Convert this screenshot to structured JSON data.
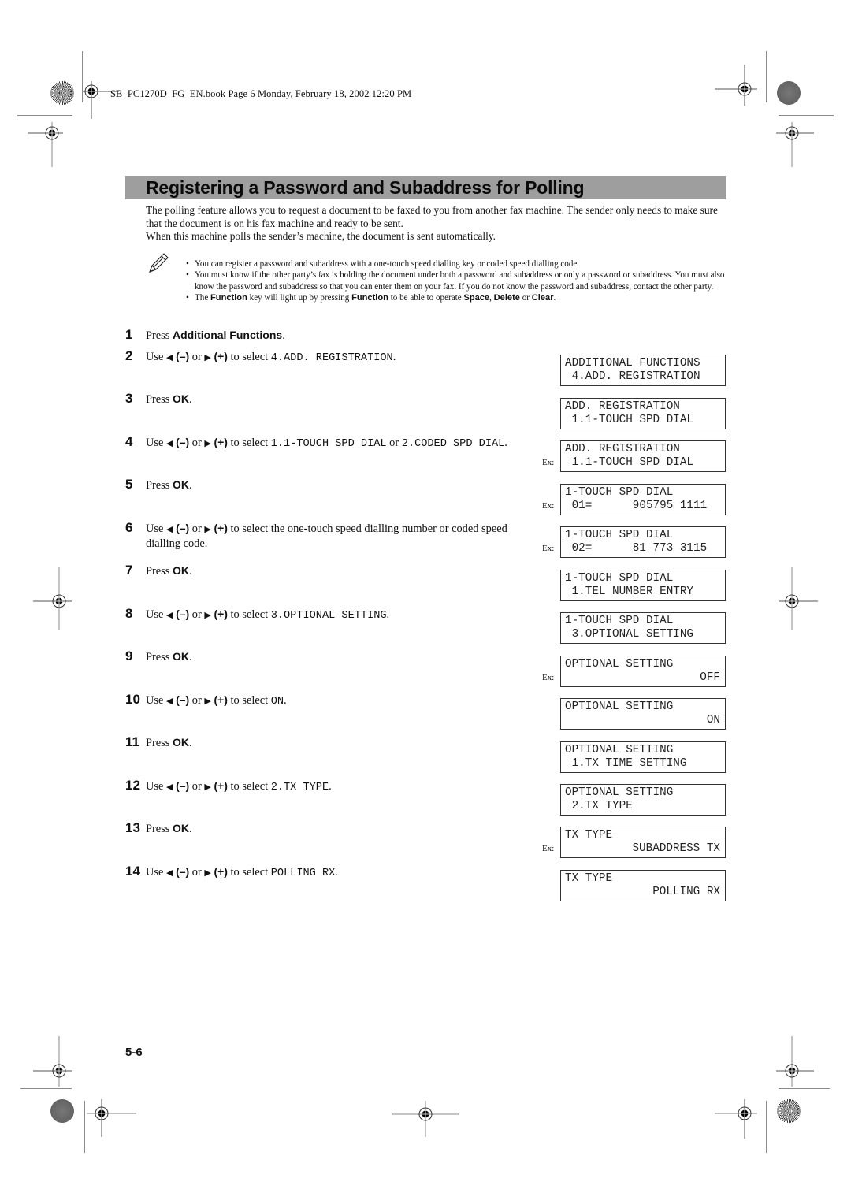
{
  "header": {
    "file_info": "SB_PC1270D_FG_EN.book  Page 6  Monday, February 18, 2002  12:20 PM"
  },
  "section": {
    "title": "Registering a Password and Subaddress for Polling",
    "intro": [
      "The polling feature allows you to request a document to be faxed to you from another fax machine. The sender only needs to make sure that the document is on his fax machine and ready to be sent.",
      "When this machine polls the sender’s machine, the document is sent automatically."
    ]
  },
  "notes": {
    "icon": "pencil-note-icon",
    "items": [
      {
        "text": "You can register a password and subaddress with a one-touch speed dialling key or coded speed dialling code."
      },
      {
        "text": "You must know if the other party’s fax is holding the document under both a password and subaddress or only a password or subaddress. You must also know the password and subaddress so that you can enter them on your fax. If you do not know the password and subaddress, contact the other party."
      },
      {
        "parts": [
          "The ",
          "Function",
          " key will light up by pressing ",
          "Function",
          " to be able to operate ",
          "Space",
          ", ",
          "Delete",
          " or ",
          "Clear",
          "."
        ]
      }
    ]
  },
  "common": {
    "use": "Use ",
    "left_arrow": "◀",
    "minus_key": "(–)",
    "or": " or ",
    "right_arrow": "▶",
    "plus_key": "(+)",
    "to_select": " to select ",
    "press": "Press ",
    "ok": "OK",
    "period": ".",
    "ex_label": "Ex:"
  },
  "steps": [
    {
      "num": "1",
      "type": "press",
      "key": "Additional Functions"
    },
    {
      "num": "2",
      "type": "select",
      "value": "4.ADD. REGISTRATION"
    },
    {
      "num": "3",
      "type": "press",
      "key": "OK"
    },
    {
      "num": "4",
      "type": "select",
      "value": "1.1-TOUCH SPD DIAL",
      "or": "or",
      "value2": "2.CODED SPD DIAL"
    },
    {
      "num": "5",
      "type": "press",
      "key": "OK"
    },
    {
      "num": "6",
      "type": "select_text",
      "text": "the one-touch speed dialling number or coded speed dialling code."
    },
    {
      "num": "7",
      "type": "press",
      "key": "OK"
    },
    {
      "num": "8",
      "type": "select",
      "value": "3.OPTIONAL SETTING"
    },
    {
      "num": "9",
      "type": "press",
      "key": "OK"
    },
    {
      "num": "10",
      "type": "select",
      "value": "ON"
    },
    {
      "num": "11",
      "type": "press",
      "key": "OK"
    },
    {
      "num": "12",
      "type": "select",
      "value": "2.TX TYPE"
    },
    {
      "num": "13",
      "type": "press",
      "key": "OK"
    },
    {
      "num": "14",
      "type": "select",
      "value": "POLLING RX"
    }
  ],
  "lcd_displays": [
    {
      "line1": "ADDITIONAL FUNCTIONS",
      "line2": " 4.ADD. REGISTRATION",
      "example": false,
      "align2": "left"
    },
    {
      "line1": "ADD. REGISTRATION",
      "line2": " 1.1-TOUCH SPD DIAL",
      "example": false,
      "align2": "left"
    },
    {
      "line1": "ADD. REGISTRATION",
      "line2": " 1.1-TOUCH SPD DIAL",
      "example": true,
      "align2": "left"
    },
    {
      "line1": "1-TOUCH SPD DIAL",
      "line2": " 01=      905795 1111",
      "example": true,
      "align2": "left"
    },
    {
      "line1": "1-TOUCH SPD DIAL",
      "line2": " 02=      81 773 3115",
      "example": true,
      "align2": "left"
    },
    {
      "line1": "1-TOUCH SPD DIAL",
      "line2": " 1.TEL NUMBER ENTRY",
      "example": false,
      "align2": "left"
    },
    {
      "line1": "1-TOUCH SPD DIAL",
      "line2": " 3.OPTIONAL SETTING",
      "example": false,
      "align2": "left"
    },
    {
      "line1": "OPTIONAL SETTING",
      "line2": "OFF",
      "example": true,
      "align2": "right"
    },
    {
      "line1": "OPTIONAL SETTING",
      "line2": "ON",
      "example": false,
      "align2": "right"
    },
    {
      "line1": "OPTIONAL SETTING",
      "line2": " 1.TX TIME SETTING",
      "example": false,
      "align2": "left"
    },
    {
      "line1": "OPTIONAL SETTING",
      "line2": " 2.TX TYPE",
      "example": false,
      "align2": "left"
    },
    {
      "line1": "TX TYPE",
      "line2": "SUBADDRESS TX",
      "example": true,
      "align2": "right"
    },
    {
      "line1": "TX TYPE",
      "line2": "POLLING RX",
      "example": false,
      "align2": "right"
    }
  ],
  "footer": {
    "page_number": "5-6"
  }
}
